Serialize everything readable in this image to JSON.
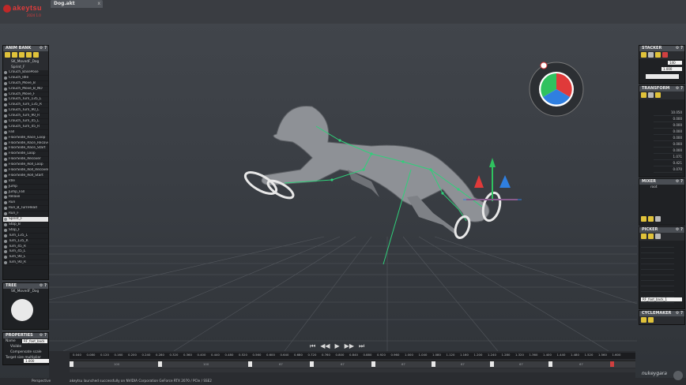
{
  "app": {
    "logo": "akeytsu",
    "version": "2024 1.0",
    "tab_title": "Dog.akt",
    "tab_close": "x"
  },
  "colors": {
    "accent": "#e23b3b",
    "rig_green": "#2fd07a",
    "gizmo_red": "#e03a3a",
    "gizmo_green": "#2fc25f",
    "gizmo_blue": "#2f7fe0",
    "tool_yellow": "#e0c23a"
  },
  "anim_bank": {
    "title": "ANIM BANK",
    "gear": "⚙ ?",
    "items": [
      "Crouch_BasePose",
      "Crouch_Idle",
      "Crouch_Move_B",
      "Crouch_Move_B_NO",
      "Crouch_Move_F",
      "Crouch_Turn_135_L",
      "Crouch_Turn_135_R",
      "Crouch_Turn_90_L",
      "Crouch_Turn_90_R",
      "Crouch_Turn_45_L",
      "Crouch_Turn_45_R",
      "Fall",
      "FloorSlide_Race_Loop",
      "FloorSlide_Race_Recover",
      "FloorSlide_Race_Start",
      "FloorSlide_Loop",
      "FloorSlide_Recover",
      "FloorSlide_Roll_Loop",
      "FloorSlide_Roll_Recover",
      "FloorSlide_Roll_Start",
      "Idle",
      "Jump",
      "Jump_Fall",
      "Relaxe",
      "Run",
      "Run_B_TurnHead",
      "Run_F",
      "Sprint_F",
      "Stop_B",
      "Stop_F",
      "Turn_135_L",
      "Turn_135_R",
      "Turn_45_R",
      "Turn_45_L",
      "Turn_90_L",
      "Turn_90_R"
    ],
    "selected": "Sprint_F",
    "top_entries": [
      "SK_MovedF_Dog",
      "Sprint_F"
    ]
  },
  "tree": {
    "title": "TREE",
    "gear": "⚙ ?",
    "entry": "SK_MovedF_Dog"
  },
  "properties": {
    "title": "PROPERTIES",
    "gear": "⚙ ?",
    "name_label": "Name",
    "name_value": "RF_foot_back",
    "visible_label": "Visible",
    "compensate_label": "Compensate scale",
    "target_size_label": "Target size multiplier",
    "target_size_value": "1.000"
  },
  "stacker": {
    "title": "STACKER",
    "gear": "⚙ ?",
    "value": "140",
    "time_value": "1.000"
  },
  "transform": {
    "title": "TRANSFORM",
    "gear": "⚙ ?",
    "values": [
      "10.050",
      "0.000",
      "0.000",
      "0.000",
      "0.000",
      "0.000",
      "0.000",
      "1.071",
      "0.421",
      "0.070"
    ]
  },
  "mixer": {
    "title": "MIXER",
    "gear": "⚙ ?",
    "entry": "root"
  },
  "picker": {
    "title": "PICKER",
    "gear": "⚙ ?",
    "selected": "RF_foot_back_1"
  },
  "cyclemaker": {
    "title": "CYCLEMAKER",
    "gear": "⚙ ?"
  },
  "viewport": {
    "label": "Perspective"
  },
  "timeline": {
    "ticks": [
      "0.040",
      "0.080",
      "0.120",
      "0.160",
      "0.200",
      "0.240",
      "0.280",
      "0.320",
      "0.360",
      "0.400",
      "0.440",
      "0.480",
      "0.520",
      "0.560",
      "0.600",
      "0.640",
      "0.680",
      "0.720",
      "0.760",
      "0.800",
      "0.840",
      "0.880",
      "0.920",
      "0.960",
      "1.000",
      "1.040",
      "1.080",
      "1.120",
      "1.160",
      "1.200",
      "1.240",
      "1.280",
      "1.320",
      "1.360",
      "1.400",
      "1.440",
      "1.480",
      "1.520",
      "1.560",
      "1.600"
    ],
    "segments": [
      "100",
      "100",
      "67",
      "67",
      "67",
      "67",
      "67",
      "67"
    ],
    "transport": [
      "⏮",
      "◀◀",
      "▶",
      "▶▶",
      "⏭"
    ]
  },
  "status": {
    "message": "akeytsu launched successfully on NVIDIA Corporation GeForce RTX 2070 / PCIe / SSE2",
    "brand": "nukeygara"
  }
}
